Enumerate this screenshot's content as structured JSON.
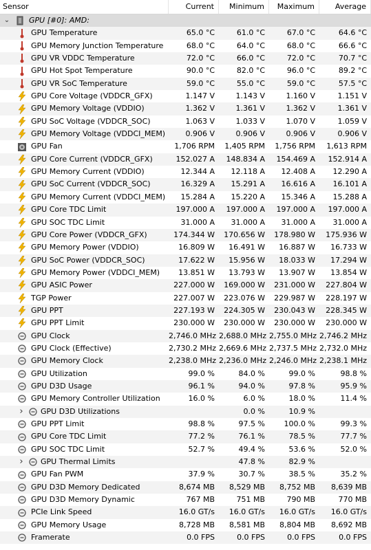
{
  "columns": {
    "sensor": "Sensor",
    "current": "Current",
    "minimum": "Minimum",
    "maximum": "Maximum",
    "average": "Average"
  },
  "group": {
    "label": "GPU [#0]: AMD:",
    "icon": "gpu-chip-icon"
  },
  "rows": [
    {
      "icon": "thermometer",
      "label": "GPU Temperature",
      "cur": "65.0 °C",
      "min": "61.0 °C",
      "max": "67.0 °C",
      "avg": "64.6 °C"
    },
    {
      "icon": "thermometer",
      "label": "GPU Memory Junction Temperature",
      "cur": "68.0 °C",
      "min": "64.0 °C",
      "max": "68.0 °C",
      "avg": "66.6 °C"
    },
    {
      "icon": "thermometer",
      "label": "GPU VR VDDC Temperature",
      "cur": "72.0 °C",
      "min": "66.0 °C",
      "max": "72.0 °C",
      "avg": "70.7 °C"
    },
    {
      "icon": "thermometer",
      "label": "GPU Hot Spot Temperature",
      "cur": "90.0 °C",
      "min": "82.0 °C",
      "max": "96.0 °C",
      "avg": "89.2 °C"
    },
    {
      "icon": "thermometer",
      "label": "GPU VR SoC Temperature",
      "cur": "59.0 °C",
      "min": "55.0 °C",
      "max": "59.0 °C",
      "avg": "57.5 °C"
    },
    {
      "icon": "bolt",
      "label": "GPU Core Voltage (VDDCR_GFX)",
      "cur": "1.147 V",
      "min": "1.143 V",
      "max": "1.160 V",
      "avg": "1.151 V"
    },
    {
      "icon": "bolt",
      "label": "GPU Memory Voltage (VDDIO)",
      "cur": "1.362 V",
      "min": "1.361 V",
      "max": "1.362 V",
      "avg": "1.361 V"
    },
    {
      "icon": "bolt",
      "label": "GPU SoC Voltage (VDDCR_SOC)",
      "cur": "1.063 V",
      "min": "1.033 V",
      "max": "1.070 V",
      "avg": "1.059 V"
    },
    {
      "icon": "bolt",
      "label": "GPU Memory Voltage (VDDCI_MEM)",
      "cur": "0.906 V",
      "min": "0.906 V",
      "max": "0.906 V",
      "avg": "0.906 V"
    },
    {
      "icon": "fan",
      "label": "GPU Fan",
      "cur": "1,706 RPM",
      "min": "1,405 RPM",
      "max": "1,756 RPM",
      "avg": "1,613 RPM"
    },
    {
      "icon": "bolt",
      "label": "GPU Core Current (VDDCR_GFX)",
      "cur": "152.027 A",
      "min": "148.834 A",
      "max": "154.469 A",
      "avg": "152.914 A"
    },
    {
      "icon": "bolt",
      "label": "GPU Memory Current (VDDIO)",
      "cur": "12.344 A",
      "min": "12.118 A",
      "max": "12.408 A",
      "avg": "12.290 A"
    },
    {
      "icon": "bolt",
      "label": "GPU SoC Current (VDDCR_SOC)",
      "cur": "16.329 A",
      "min": "15.291 A",
      "max": "16.616 A",
      "avg": "16.101 A"
    },
    {
      "icon": "bolt",
      "label": "GPU Memory Current (VDDCI_MEM)",
      "cur": "15.284 A",
      "min": "15.220 A",
      "max": "15.346 A",
      "avg": "15.288 A"
    },
    {
      "icon": "bolt",
      "label": "GPU Core TDC Limit",
      "cur": "197.000 A",
      "min": "197.000 A",
      "max": "197.000 A",
      "avg": "197.000 A"
    },
    {
      "icon": "bolt",
      "label": "GPU SOC TDC Limit",
      "cur": "31.000 A",
      "min": "31.000 A",
      "max": "31.000 A",
      "avg": "31.000 A"
    },
    {
      "icon": "bolt",
      "label": "GPU Core Power (VDDCR_GFX)",
      "cur": "174.344 W",
      "min": "170.656 W",
      "max": "178.980 W",
      "avg": "175.936 W"
    },
    {
      "icon": "bolt",
      "label": "GPU Memory Power (VDDIO)",
      "cur": "16.809 W",
      "min": "16.491 W",
      "max": "16.887 W",
      "avg": "16.733 W"
    },
    {
      "icon": "bolt",
      "label": "GPU SoC Power (VDDCR_SOC)",
      "cur": "17.622 W",
      "min": "15.956 W",
      "max": "18.033 W",
      "avg": "17.294 W"
    },
    {
      "icon": "bolt",
      "label": "GPU Memory Power (VDDCI_MEM)",
      "cur": "13.851 W",
      "min": "13.793 W",
      "max": "13.907 W",
      "avg": "13.854 W"
    },
    {
      "icon": "bolt",
      "label": "GPU ASIC Power",
      "cur": "227.000 W",
      "min": "169.000 W",
      "max": "231.000 W",
      "avg": "227.804 W"
    },
    {
      "icon": "bolt",
      "label": "TGP Power",
      "cur": "227.007 W",
      "min": "223.076 W",
      "max": "229.987 W",
      "avg": "228.197 W"
    },
    {
      "icon": "bolt",
      "label": "GPU PPT",
      "cur": "227.193 W",
      "min": "224.305 W",
      "max": "230.043 W",
      "avg": "228.345 W"
    },
    {
      "icon": "bolt",
      "label": "GPU PPT Limit",
      "cur": "230.000 W",
      "min": "230.000 W",
      "max": "230.000 W",
      "avg": "230.000 W"
    },
    {
      "icon": "gauge",
      "label": "GPU Clock",
      "cur": "2,746.0 MHz",
      "min": "2,688.0 MHz",
      "max": "2,755.0 MHz",
      "avg": "2,746.2 MHz"
    },
    {
      "icon": "gauge",
      "label": "GPU Clock (Effective)",
      "cur": "2,730.2 MHz",
      "min": "2,669.6 MHz",
      "max": "2,737.5 MHz",
      "avg": "2,732.0 MHz"
    },
    {
      "icon": "gauge",
      "label": "GPU Memory Clock",
      "cur": "2,238.0 MHz",
      "min": "2,236.0 MHz",
      "max": "2,246.0 MHz",
      "avg": "2,238.1 MHz"
    },
    {
      "icon": "gauge",
      "label": "GPU Utilization",
      "cur": "99.0 %",
      "min": "84.0 %",
      "max": "99.0 %",
      "avg": "98.8 %"
    },
    {
      "icon": "gauge",
      "label": "GPU D3D Usage",
      "cur": "96.1 %",
      "min": "94.0 %",
      "max": "97.8 %",
      "avg": "95.9 %"
    },
    {
      "icon": "gauge",
      "label": "GPU Memory Controller Utilization",
      "cur": "16.0 %",
      "min": "6.0 %",
      "max": "18.0 %",
      "avg": "11.4 %"
    },
    {
      "icon": "gauge",
      "label": "GPU D3D Utilizations",
      "cur": "",
      "min": "0.0 %",
      "max": "10.9 %",
      "avg": "",
      "expandable": true
    },
    {
      "icon": "gauge",
      "label": "GPU PPT Limit",
      "cur": "98.8 %",
      "min": "97.5 %",
      "max": "100.0 %",
      "avg": "99.3 %"
    },
    {
      "icon": "gauge",
      "label": "GPU Core TDC Limit",
      "cur": "77.2 %",
      "min": "76.1 %",
      "max": "78.5 %",
      "avg": "77.7 %"
    },
    {
      "icon": "gauge",
      "label": "GPU SOC TDC Limit",
      "cur": "52.7 %",
      "min": "49.4 %",
      "max": "53.6 %",
      "avg": "52.0 %"
    },
    {
      "icon": "gauge",
      "label": "GPU Thermal Limits",
      "cur": "",
      "min": "47.8 %",
      "max": "82.9 %",
      "avg": "",
      "expandable": true
    },
    {
      "icon": "gauge",
      "label": "GPU Fan PWM",
      "cur": "37.9 %",
      "min": "30.7 %",
      "max": "38.5 %",
      "avg": "35.2 %"
    },
    {
      "icon": "gauge",
      "label": "GPU D3D Memory Dedicated",
      "cur": "8,674 MB",
      "min": "8,529 MB",
      "max": "8,752 MB",
      "avg": "8,639 MB"
    },
    {
      "icon": "gauge",
      "label": "GPU D3D Memory Dynamic",
      "cur": "767 MB",
      "min": "751 MB",
      "max": "790 MB",
      "avg": "770 MB"
    },
    {
      "icon": "gauge",
      "label": "PCIe Link Speed",
      "cur": "16.0 GT/s",
      "min": "16.0 GT/s",
      "max": "16.0 GT/s",
      "avg": "16.0 GT/s"
    },
    {
      "icon": "gauge",
      "label": "GPU Memory Usage",
      "cur": "8,728 MB",
      "min": "8,581 MB",
      "max": "8,804 MB",
      "avg": "8,692 MB"
    },
    {
      "icon": "gauge",
      "label": "Framerate",
      "cur": "0.0 FPS",
      "min": "0.0 FPS",
      "max": "0.0 FPS",
      "avg": "0.0 FPS"
    }
  ],
  "colors": {
    "thermometer": "#c0392b",
    "bolt": "#f0b400",
    "fan": "#555555",
    "gauge": "#666666"
  }
}
